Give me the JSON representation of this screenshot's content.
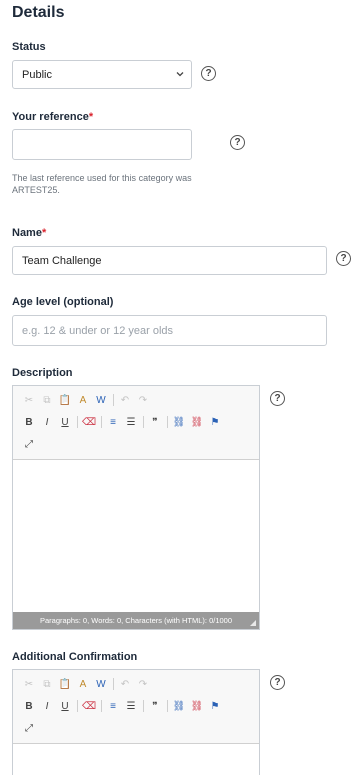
{
  "section_title": "Details",
  "status": {
    "label": "Status",
    "value": "Public"
  },
  "your_reference": {
    "label": "Your reference",
    "required_mark": "*",
    "value": "",
    "note_line1": "The last reference used for this category was",
    "note_line2": "ARTEST25."
  },
  "name": {
    "label": "Name",
    "required_mark": "*",
    "value": "Team Challenge"
  },
  "age_level": {
    "label": "Age level (optional)",
    "placeholder": "e.g. 12 & under or 12 year olds"
  },
  "description": {
    "label": "Description",
    "statusbar": "Paragraphs: 0, Words: 0, Characters (with HTML): 0/1000"
  },
  "additional_confirmation": {
    "label": "Additional Confirmation"
  },
  "toolbar": {
    "row1": [
      {
        "name": "cut-icon",
        "glyph": "✂",
        "state": "dis"
      },
      {
        "name": "copy-icon",
        "glyph": "⧉",
        "state": "dis"
      },
      {
        "name": "paste-icon",
        "glyph": "📋",
        "state": "paste"
      },
      {
        "name": "paste-text-icon",
        "glyph": "A",
        "state": "paste"
      },
      {
        "name": "paste-from-word-icon",
        "glyph": "W",
        "state": "blue"
      },
      {
        "sep": true
      },
      {
        "name": "undo-icon",
        "glyph": "↶",
        "state": "dis"
      },
      {
        "name": "redo-icon",
        "glyph": "↷",
        "state": "dis"
      }
    ],
    "row2": [
      {
        "name": "bold-icon",
        "glyph": "B",
        "state": ""
      },
      {
        "name": "italic-icon",
        "glyph": "I",
        "state": ""
      },
      {
        "name": "underline-icon",
        "glyph": "U",
        "state": ""
      },
      {
        "sep": true
      },
      {
        "name": "remove-format-icon",
        "glyph": "⌫",
        "state": "red"
      },
      {
        "sep": true
      },
      {
        "name": "numbered-list-icon",
        "glyph": "≡",
        "state": "blue"
      },
      {
        "name": "bulleted-list-icon",
        "glyph": "☰",
        "state": ""
      },
      {
        "sep": true
      },
      {
        "name": "blockquote-icon",
        "glyph": "❞",
        "state": ""
      },
      {
        "sep": true
      },
      {
        "name": "link-icon",
        "glyph": "⛓",
        "state": "blue"
      },
      {
        "name": "unlink-icon",
        "glyph": "⛓",
        "state": "red"
      },
      {
        "name": "anchor-flag-icon",
        "glyph": "⚑",
        "state": "blue"
      }
    ],
    "row3": [
      {
        "name": "maximize-icon",
        "glyph": "⤢",
        "state": ""
      }
    ]
  }
}
